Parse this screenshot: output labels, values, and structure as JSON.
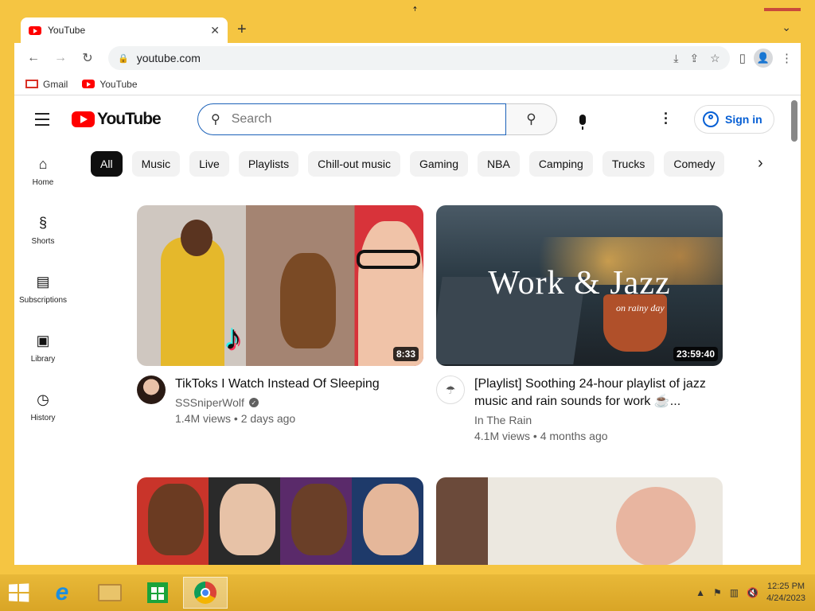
{
  "browser": {
    "tab_title": "YouTube",
    "url": "youtube.com",
    "bookmarks": [
      {
        "label": "Gmail",
        "icon": "gmail-icon"
      },
      {
        "label": "YouTube",
        "icon": "youtube-icon"
      }
    ]
  },
  "youtube": {
    "logo_text": "YouTube",
    "search_placeholder": "Search",
    "signin_label": "Sign in",
    "sidebar": [
      {
        "label": "Home",
        "icon": "home-icon"
      },
      {
        "label": "Shorts",
        "icon": "shorts-icon"
      },
      {
        "label": "Subscriptions",
        "icon": "subscriptions-icon"
      },
      {
        "label": "Library",
        "icon": "library-icon"
      },
      {
        "label": "History",
        "icon": "history-icon"
      }
    ],
    "chips": [
      "All",
      "Music",
      "Live",
      "Playlists",
      "Chill-out music",
      "Gaming",
      "NBA",
      "Camping",
      "Trucks",
      "Comedy"
    ],
    "videos": [
      {
        "title": "TikToks I Watch Instead Of Sleeping",
        "channel": "SSSniperWolf",
        "verified": true,
        "stats": "1.4M views • 2 days ago",
        "duration": "8:33"
      },
      {
        "title": "[Playlist] Soothing 24-hour playlist of jazz music and rain sounds for work ☕...",
        "channel": "In The Rain",
        "verified": false,
        "stats": "4.1M views • 4 months ago",
        "duration": "23:59:40",
        "thumb_text": "Work & Jazz",
        "thumb_subtext": "on rainy day"
      },
      {
        "title": "",
        "channel": "",
        "stats": ""
      },
      {
        "title": "",
        "channel": "",
        "stats": ""
      }
    ]
  },
  "taskbar": {
    "time": "12:25 PM",
    "date": "4/24/2023"
  },
  "colors": {
    "accent_yellow": "#f5c542",
    "youtube_red": "#ff0000",
    "link_blue": "#065fd4"
  }
}
